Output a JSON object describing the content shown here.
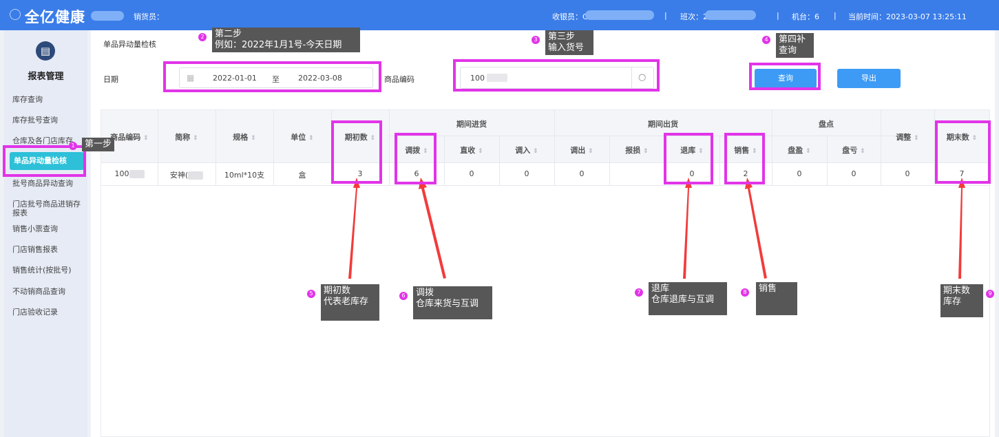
{
  "topbar": {
    "brand": "全亿健康",
    "salesperson_label": "销货员：",
    "cashier_label": "收银员：C",
    "shift_label": "班次：2:",
    "terminal": "机台：6",
    "current_time": "当前时间：2023-03-07 13:25:11",
    "separator": "|",
    "accent_color": "#3b7de8"
  },
  "sidebar": {
    "title": "报表管理",
    "items": [
      "库存查询",
      "库存批号查询",
      "仓库及各门店库存",
      "单品异动量检核",
      "批号商品异动查询",
      "门店批号商品进销存报表",
      "销售小票查询",
      "门店销售报表",
      "销售统计(按批号)",
      "不动销商品查询",
      "门店验收记录"
    ]
  },
  "page": {
    "title": "单品异动量检核",
    "date_label": "日期",
    "date_start": "2022-01-01",
    "date_to": "至",
    "date_end": "2022-03-08",
    "code_label": "商品编码",
    "code_value": "100",
    "query_button": "查询",
    "export_button": "导出"
  },
  "table": {
    "group_in": "期间进货",
    "group_out": "期间出货",
    "group_check": "盘点",
    "headers": {
      "code": "商品编码",
      "name": "简称",
      "spec": "规格",
      "unit": "单位",
      "opening": "期初数",
      "transfer": "调拨",
      "direct": "直收",
      "transfer_in": "调入",
      "transfer_out": "调出",
      "loss": "报损",
      "return": "退库",
      "sales": "销售",
      "surplus": "盘盈",
      "deficit": "盘亏",
      "adjust": "调整",
      "closing": "期末数"
    },
    "row": {
      "code": "100",
      "name": "安神(",
      "spec": "10ml*10支",
      "unit": "盒",
      "opening": "3",
      "transfer": "6",
      "direct": "0",
      "transfer_in": "0",
      "transfer_out": "0",
      "loss": "",
      "return": "0",
      "sales": "2",
      "surplus": "0",
      "deficit": "0",
      "adjust": "0",
      "closing": "7"
    }
  },
  "annotations": {
    "step1": {
      "num": "1",
      "line1": "第一步"
    },
    "step2": {
      "num": "2",
      "line1": "第二步",
      "line2": "例如：2022年1月1号-今天日期"
    },
    "step3": {
      "num": "3",
      "line1": "第三步",
      "line2": "输入货号"
    },
    "step4": {
      "num": "4",
      "line1": "第四补",
      "line2": "查询"
    },
    "note5": {
      "num": "5",
      "line1": "期初数",
      "line2": "代表老库存"
    },
    "note6": {
      "num": "6",
      "line1": "调拨",
      "line2": "仓库来货与互调"
    },
    "note7": {
      "num": "7",
      "line1": "退库",
      "line2": "仓库退库与互调"
    },
    "note8": {
      "num": "8",
      "line1": "销售"
    },
    "note9": {
      "num": "9",
      "line1": "期末数",
      "line2": "库存"
    },
    "highlight_color": "#e134e8",
    "arrow_color": "#f23b3b"
  }
}
